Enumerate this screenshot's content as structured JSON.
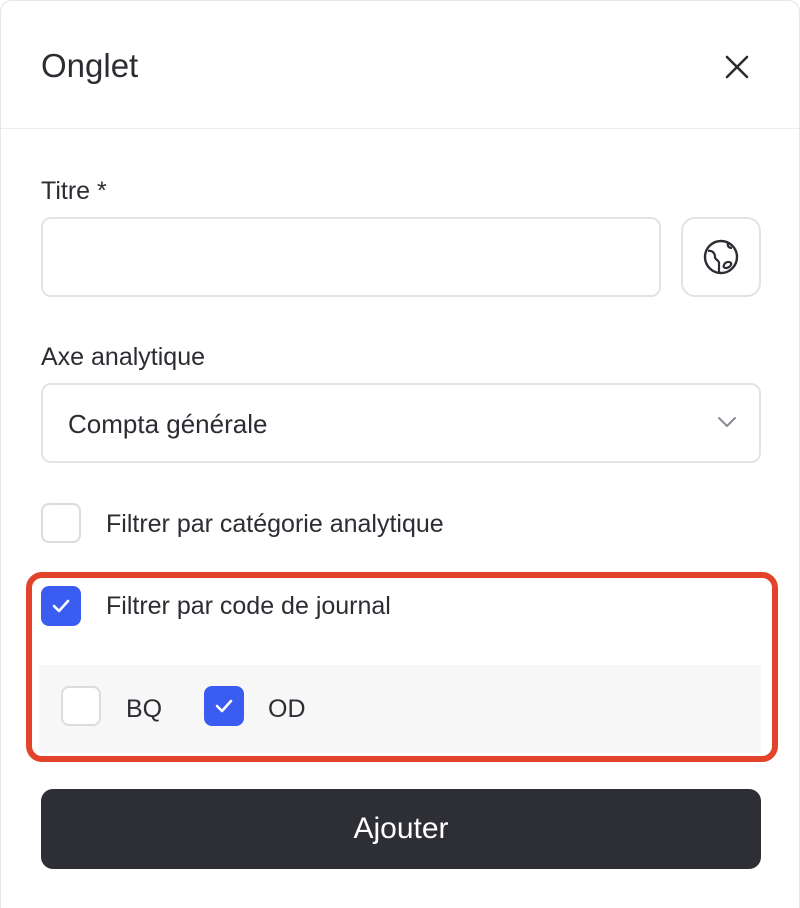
{
  "dialog": {
    "title": "Onglet",
    "close_icon": "close-icon"
  },
  "form": {
    "title_field": {
      "label": "Titre *",
      "value": "",
      "placeholder": "",
      "translate_icon": "globe-icon"
    },
    "axis_field": {
      "label": "Axe analytique",
      "selected": "Compta générale",
      "chevron_icon": "chevron-down-icon"
    },
    "filter_category": {
      "label": "Filtrer par catégorie analytique",
      "checked": false
    },
    "filter_journal": {
      "label": "Filtrer par code de journal",
      "checked": true,
      "codes": [
        {
          "label": "BQ",
          "checked": false
        },
        {
          "label": "OD",
          "checked": true
        }
      ]
    },
    "submit_label": "Ajouter"
  },
  "colors": {
    "accent": "#3b5cf0",
    "primary_button": "#2e2f34",
    "highlight": "#e2432a",
    "border": "#e3e3e6"
  }
}
